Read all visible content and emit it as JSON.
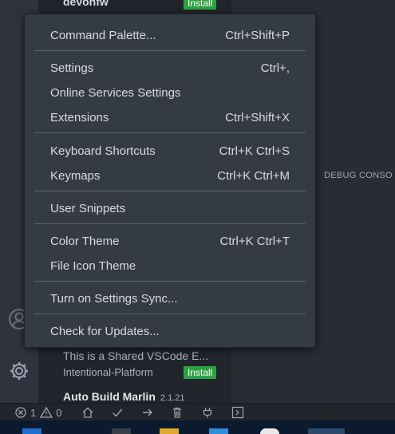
{
  "sidebar": {
    "top_extension_name": "devonfw",
    "install_label": "Install",
    "extension_description": "This is a Shared VSCode E...",
    "extension_publisher": "Intentional-Platform",
    "next_extension_title": "Auto Build Marlin",
    "next_extension_version": "2.1.21"
  },
  "panel": {
    "debug_console_tab": "DEBUG CONSO"
  },
  "menu": {
    "items": [
      {
        "label": "Command Palette...",
        "shortcut": "Ctrl+Shift+P"
      },
      {
        "label": "Settings",
        "shortcut": "Ctrl+,"
      },
      {
        "label": "Online Services Settings",
        "shortcut": ""
      },
      {
        "label": "Extensions",
        "shortcut": "Ctrl+Shift+X"
      },
      {
        "label": "Keyboard Shortcuts",
        "shortcut": "Ctrl+K Ctrl+S"
      },
      {
        "label": "Keymaps",
        "shortcut": "Ctrl+K Ctrl+M"
      },
      {
        "label": "User Snippets",
        "shortcut": ""
      },
      {
        "label": "Color Theme",
        "shortcut": "Ctrl+K Ctrl+T"
      },
      {
        "label": "File Icon Theme",
        "shortcut": ""
      },
      {
        "label": "Turn on Settings Sync...",
        "shortcut": ""
      },
      {
        "label": "Check for Updates...",
        "shortcut": ""
      }
    ]
  },
  "statusbar": {
    "errors_count": "1",
    "warnings_count": "0"
  },
  "colors": {
    "menu_bg": "#353b45",
    "install_badge": "#2ea043",
    "text": "#d7dae0"
  }
}
